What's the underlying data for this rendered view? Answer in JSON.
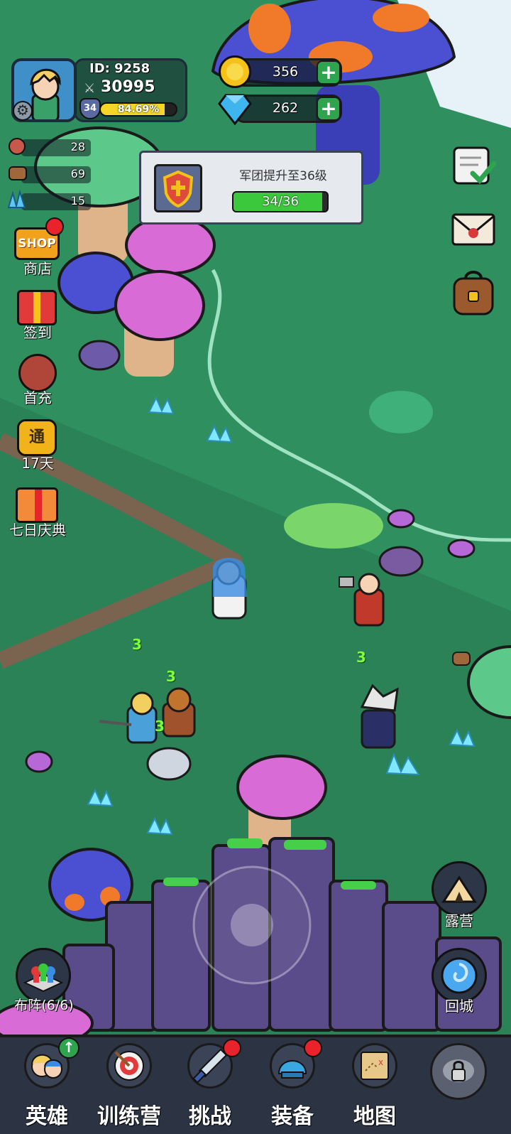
{
  "player": {
    "id_label": "ID: 9258",
    "power": "30995",
    "level": "34",
    "exp_percent": "84.69%",
    "exp_fraction": 0.8469
  },
  "currency": {
    "gold": "356",
    "diamond": "262"
  },
  "resources": [
    {
      "icon": "meat-icon",
      "value": "28"
    },
    {
      "icon": "wood-icon",
      "value": "69"
    },
    {
      "icon": "crystal-icon",
      "value": "15"
    }
  ],
  "quest": {
    "title": "军团提升至36级",
    "progress": "34/36",
    "progress_fraction": 0.944
  },
  "side_menu": [
    {
      "name": "shop",
      "label": "商店",
      "badge": true,
      "badge_text": "SHOP"
    },
    {
      "name": "checkin",
      "label": "签到",
      "badge": false
    },
    {
      "name": "first-recharge",
      "label": "首充",
      "badge": false
    },
    {
      "name": "pass",
      "label": "17天",
      "badge": false,
      "badge_text": "通"
    },
    {
      "name": "seven-day",
      "label": "七日庆典",
      "badge": false
    }
  ],
  "right_menu": [
    {
      "name": "tasks-icon"
    },
    {
      "name": "mail-icon"
    },
    {
      "name": "backpack-icon"
    }
  ],
  "damage_numbers": [
    "3",
    "3",
    "3",
    "3"
  ],
  "buttons": {
    "camp": "露营",
    "return_city": "回城",
    "formation": "布阵(6/6)"
  },
  "tabs": [
    {
      "label": "英雄",
      "badge": "upgrade"
    },
    {
      "label": "训练营",
      "badge": "none"
    },
    {
      "label": "挑战",
      "badge": "red"
    },
    {
      "label": "装备",
      "badge": "red"
    },
    {
      "label": "地图",
      "badge": "none"
    },
    {
      "label": "",
      "badge": "locked"
    }
  ],
  "colors": {
    "grass": "#2f8f5e",
    "grass_dark": "#267a50",
    "path": "#7a6450",
    "mushroom_pink": "#d96bd6",
    "mushroom_blue": "#4b4fd1",
    "progress_green": "#3cc83c",
    "exp_yellow": "#f4d528"
  }
}
